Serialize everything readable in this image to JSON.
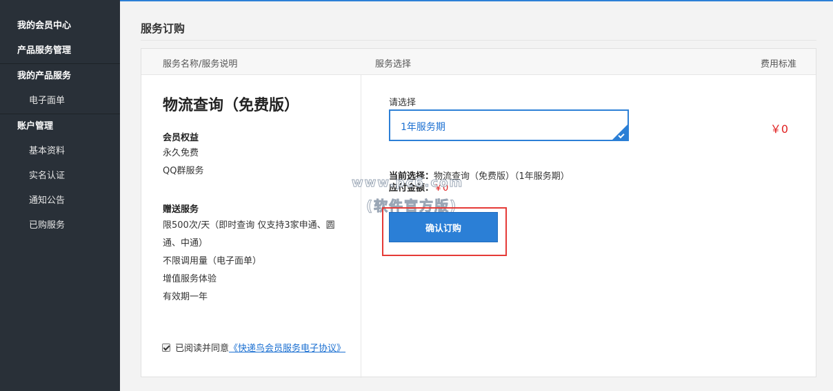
{
  "sidebar": {
    "items": [
      {
        "type": "group",
        "label": "我的会员中心"
      },
      {
        "type": "group",
        "label": "产品服务管理"
      },
      {
        "type": "group",
        "label": "我的产品服务"
      },
      {
        "type": "item",
        "label": "电子面单"
      },
      {
        "type": "group",
        "label": "账户管理"
      },
      {
        "type": "item",
        "label": "基本资料"
      },
      {
        "type": "item",
        "label": "实名认证"
      },
      {
        "type": "item",
        "label": "通知公告"
      },
      {
        "type": "item",
        "label": "已购服务"
      }
    ]
  },
  "page": {
    "title": "服务订购"
  },
  "table": {
    "headers": [
      "服务名称/服务说明",
      "服务选择",
      "费用标准"
    ]
  },
  "service": {
    "name": "物流查询（免费版）",
    "benefits_title": "会员权益",
    "benefits": [
      "永久免费",
      "QQ群服务"
    ],
    "gifts_title": "赠送服务",
    "gifts": [
      "限500次/天（即时查询 仅支持3家申通、圆",
      "通、中通）",
      "不限调用量（电子面单）",
      "增值服务体验",
      "有效期一年"
    ]
  },
  "agreement": {
    "checked": true,
    "text": "已阅读并同意",
    "link": "《快递鸟会员服务电子协议》"
  },
  "selection": {
    "label": "请选择",
    "value": "1年服务期",
    "price": "￥0",
    "current_label": "当前选择：",
    "current_value": "物流查询（免费版）（1年服务期）",
    "amount_label": "应付金额：",
    "amount_value": "￥0"
  },
  "watermark": {
    "line1": "www.pc6.com",
    "line2": "(软件官方版)"
  },
  "actions": {
    "confirm": "确认订购"
  },
  "colors": {
    "accent": "#2b7fd6",
    "price": "#e02020",
    "sidebar": "#293038",
    "highlight": "#e53935"
  }
}
